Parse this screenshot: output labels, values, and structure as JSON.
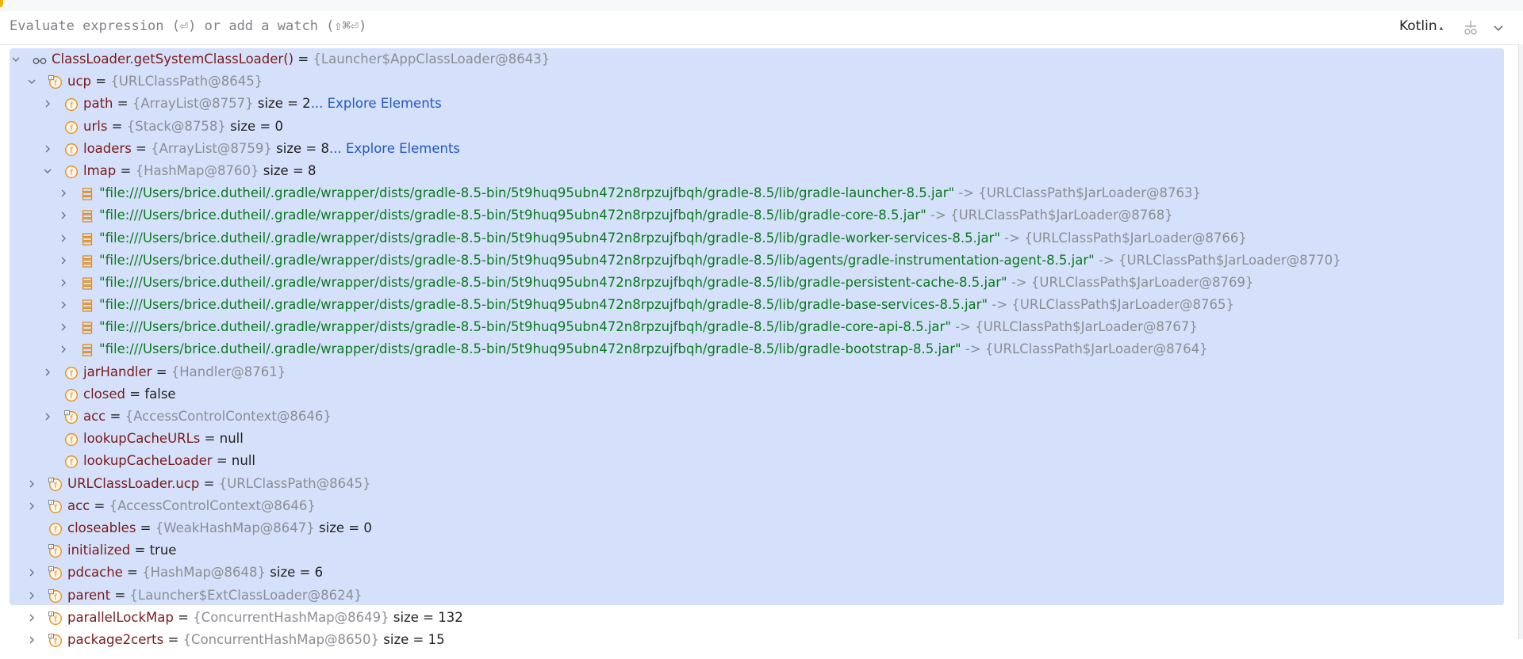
{
  "eval_bar": {
    "placeholder": "Evaluate expression (⏎) or add a watch (⇧⌘⏎)",
    "language": "Kotlin",
    "language_caret": "▴",
    "tool_icons": [
      "add-watch-icon",
      "chevron-down-icon"
    ]
  },
  "colors": {
    "selection": "#d5e1fa",
    "field_name": "#7a1a1a",
    "reference": "#8a8d93",
    "string": "#097a1e",
    "link": "#2456c4",
    "field_icon": "#e08a1e"
  },
  "tree": [
    {
      "depth": 0,
      "expander": "expanded",
      "icon": "watch",
      "name": "ClassLoader.getSystemClassLoader()",
      "ref": "{Launcher$AppClassLoader@8643}"
    },
    {
      "depth": 1,
      "expander": "expanded",
      "icon": "field-locked",
      "name": "ucp",
      "ref": "{URLClassPath@8645}"
    },
    {
      "depth": 2,
      "expander": "collapsed",
      "icon": "field",
      "name": "path",
      "ref": "{ArrayList@8757}",
      "size": "size = 2",
      "link": "... Explore Elements"
    },
    {
      "depth": 2,
      "expander": "none",
      "icon": "field",
      "name": "urls",
      "ref": "{Stack@8758}",
      "size": "size = 0"
    },
    {
      "depth": 2,
      "expander": "collapsed",
      "icon": "field",
      "name": "loaders",
      "ref": "{ArrayList@8759}",
      "size": "size = 8",
      "link": "... Explore Elements"
    },
    {
      "depth": 2,
      "expander": "expanded",
      "icon": "field",
      "name": "lmap",
      "ref": "{HashMap@8760}",
      "size": "size = 8"
    },
    {
      "depth": 3,
      "expander": "collapsed",
      "icon": "map-entry",
      "key": "\"file:///Users/brice.dutheil/.gradle/wrapper/dists/gradle-8.5-bin/5t9huq95ubn472n8rpzujfbqh/gradle-8.5/lib/gradle-launcher-8.5.jar\"",
      "arrow": " -> ",
      "ref": "{URLClassPath$JarLoader@8763}"
    },
    {
      "depth": 3,
      "expander": "collapsed",
      "icon": "map-entry",
      "key": "\"file:///Users/brice.dutheil/.gradle/wrapper/dists/gradle-8.5-bin/5t9huq95ubn472n8rpzujfbqh/gradle-8.5/lib/gradle-core-8.5.jar\"",
      "arrow": " -> ",
      "ref": "{URLClassPath$JarLoader@8768}"
    },
    {
      "depth": 3,
      "expander": "collapsed",
      "icon": "map-entry",
      "key": "\"file:///Users/brice.dutheil/.gradle/wrapper/dists/gradle-8.5-bin/5t9huq95ubn472n8rpzujfbqh/gradle-8.5/lib/gradle-worker-services-8.5.jar\"",
      "arrow": " -> ",
      "ref": "{URLClassPath$JarLoader@8766}"
    },
    {
      "depth": 3,
      "expander": "collapsed",
      "icon": "map-entry",
      "key": "\"file:///Users/brice.dutheil/.gradle/wrapper/dists/gradle-8.5-bin/5t9huq95ubn472n8rpzujfbqh/gradle-8.5/lib/agents/gradle-instrumentation-agent-8.5.jar\"",
      "arrow": " -> ",
      "ref": "{URLClassPath$JarLoader@8770}"
    },
    {
      "depth": 3,
      "expander": "collapsed",
      "icon": "map-entry",
      "key": "\"file:///Users/brice.dutheil/.gradle/wrapper/dists/gradle-8.5-bin/5t9huq95ubn472n8rpzujfbqh/gradle-8.5/lib/gradle-persistent-cache-8.5.jar\"",
      "arrow": " -> ",
      "ref": "{URLClassPath$JarLoader@8769}"
    },
    {
      "depth": 3,
      "expander": "collapsed",
      "icon": "map-entry",
      "key": "\"file:///Users/brice.dutheil/.gradle/wrapper/dists/gradle-8.5-bin/5t9huq95ubn472n8rpzujfbqh/gradle-8.5/lib/gradle-base-services-8.5.jar\"",
      "arrow": " -> ",
      "ref": "{URLClassPath$JarLoader@8765}"
    },
    {
      "depth": 3,
      "expander": "collapsed",
      "icon": "map-entry",
      "key": "\"file:///Users/brice.dutheil/.gradle/wrapper/dists/gradle-8.5-bin/5t9huq95ubn472n8rpzujfbqh/gradle-8.5/lib/gradle-core-api-8.5.jar\"",
      "arrow": " -> ",
      "ref": "{URLClassPath$JarLoader@8767}"
    },
    {
      "depth": 3,
      "expander": "collapsed",
      "icon": "map-entry",
      "key": "\"file:///Users/brice.dutheil/.gradle/wrapper/dists/gradle-8.5-bin/5t9huq95ubn472n8rpzujfbqh/gradle-8.5/lib/gradle-bootstrap-8.5.jar\"",
      "arrow": " -> ",
      "ref": "{URLClassPath$JarLoader@8764}"
    },
    {
      "depth": 2,
      "expander": "collapsed",
      "icon": "field",
      "name": "jarHandler",
      "ref": "{Handler@8761}"
    },
    {
      "depth": 2,
      "expander": "none",
      "icon": "field",
      "name": "closed",
      "value": "false"
    },
    {
      "depth": 2,
      "expander": "collapsed",
      "icon": "field-locked",
      "name": "acc",
      "ref": "{AccessControlContext@8646}"
    },
    {
      "depth": 2,
      "expander": "none",
      "icon": "field",
      "name": "lookupCacheURLs",
      "value": "null"
    },
    {
      "depth": 2,
      "expander": "none",
      "icon": "field",
      "name": "lookupCacheLoader",
      "value": "null"
    },
    {
      "depth": 1,
      "expander": "collapsed",
      "icon": "field-locked",
      "name": "URLClassLoader.ucp",
      "ref": "{URLClassPath@8645}"
    },
    {
      "depth": 1,
      "expander": "collapsed",
      "icon": "field-locked",
      "name": "acc",
      "ref": "{AccessControlContext@8646}"
    },
    {
      "depth": 1,
      "expander": "none",
      "icon": "field",
      "name": "closeables",
      "ref": "{WeakHashMap@8647}",
      "size": "size = 0"
    },
    {
      "depth": 1,
      "expander": "none",
      "icon": "field-locked",
      "name": "initialized",
      "value": "true"
    },
    {
      "depth": 1,
      "expander": "collapsed",
      "icon": "field-locked",
      "name": "pdcache",
      "ref": "{HashMap@8648}",
      "size": "size = 6"
    },
    {
      "depth": 1,
      "expander": "collapsed",
      "icon": "field-locked",
      "name": "parent",
      "ref": "{Launcher$ExtClassLoader@8624}"
    },
    {
      "depth": 1,
      "expander": "collapsed",
      "icon": "field-locked",
      "name": "parallelLockMap",
      "ref": "{ConcurrentHashMap@8649}",
      "size": "size = 132"
    },
    {
      "depth": 1,
      "expander": "collapsed",
      "icon": "field-locked",
      "name": "package2certs",
      "ref": "{ConcurrentHashMap@8650}",
      "size": "size = 15"
    }
  ]
}
